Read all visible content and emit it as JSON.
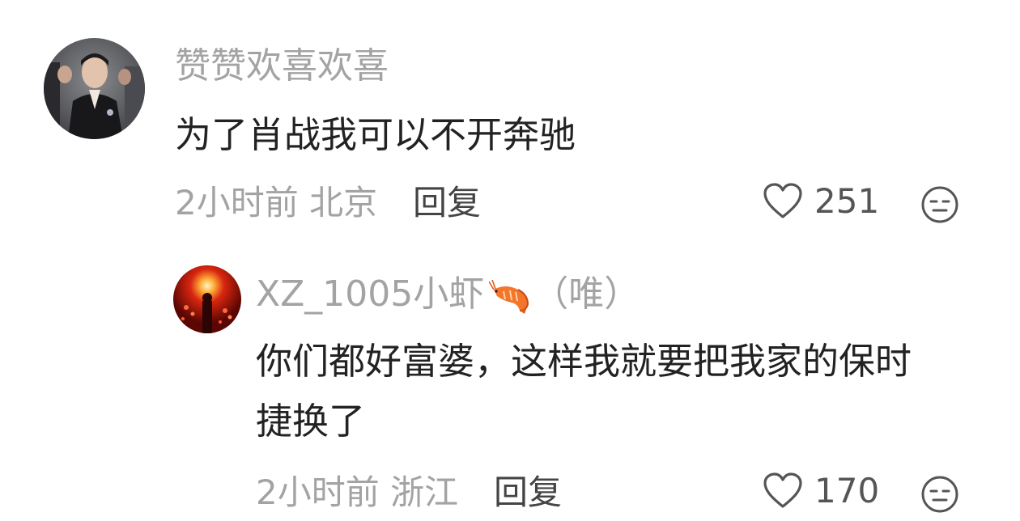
{
  "comments": [
    {
      "username": "赞赞欢喜欢喜",
      "text_lines": [
        "为了肖战我可以不开奔驰"
      ],
      "time": "2小时前",
      "location": "北京",
      "reply_label": "回复",
      "likes": "251",
      "avatar_icon": "user-avatar-photo"
    },
    {
      "username": "XZ_1005小虾",
      "username_suffix": "（唯）",
      "username_emoji": "shrimp-icon",
      "text_lines": [
        "你们都好富婆，这样我就要把我家的保时",
        "捷换了"
      ],
      "time": "2小时前",
      "location": "浙江",
      "reply_label": "回复",
      "likes": "170",
      "avatar_icon": "user-avatar-red-lights"
    }
  ],
  "colors": {
    "meta_gray": "#a3a3a3",
    "text_dark": "#222222",
    "reply_dark": "#444444",
    "icon_gray": "#555555"
  }
}
